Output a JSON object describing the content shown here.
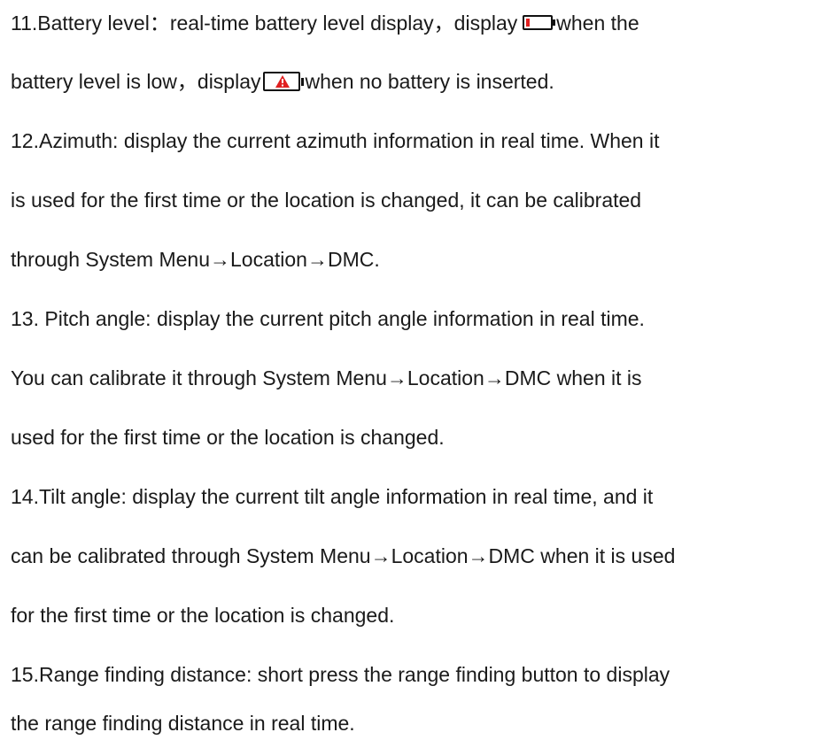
{
  "items": {
    "battery": {
      "line1_before": "11.Battery level：real-time battery level display，display",
      "line1_after": "when the",
      "line2_before": "battery level is low，display",
      "line2_after": "when no battery is inserted.",
      "icon_low": "battery-low-icon",
      "icon_missing": "no-battery-warning-icon",
      "warning_color": "#e02020"
    },
    "azimuth": {
      "line1": "12.Azimuth: display the current azimuth information in real time. When it",
      "line2": "is used for the first time or the location is changed, it can be calibrated",
      "line3": "through System Menu→Location→DMC."
    },
    "pitch": {
      "line1": "13. Pitch angle: display the current pitch angle information in real time.",
      "line2": "You can calibrate it through System Menu→Location→DMC when it is",
      "line3": "used for the first time or the location is changed."
    },
    "tilt": {
      "line1": "14.Tilt angle: display the current tilt angle information in real time, and it",
      "line2": "can be calibrated through System Menu→Location→DMC when it is used",
      "line3": "for the first time or the location is changed."
    },
    "range": {
      "line1": "15.Range finding distance: short press the range finding button to display",
      "line2": "the range finding distance in real time."
    }
  }
}
